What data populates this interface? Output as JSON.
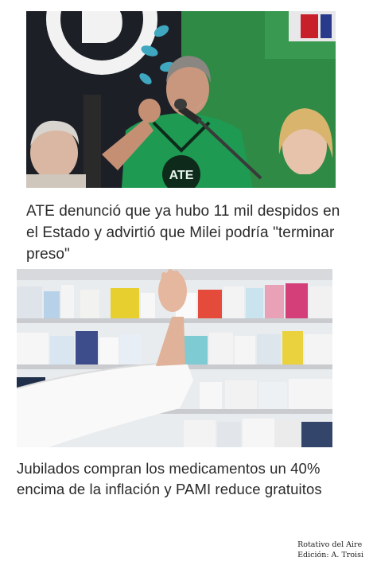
{
  "stories": [
    {
      "headline": "ATE denunció que ya hubo 11 mil despidos en el Estado y advirtió que Milei podría \"terminar preso\"",
      "image": "protest-speaker-photo"
    },
    {
      "headline": "Jubilados compran los medicamentos un 40% encima de la inflación y PAMI reduce gratuitos",
      "image": "pharmacy-shelves-photo"
    }
  ],
  "credits": {
    "line1": "Rotativo del Aire",
    "line2": "Edición: A. Troisi"
  },
  "colors": {
    "headline_text": "#2a2a2a",
    "shirt_green": "#1e9a52",
    "banner_green": "#2f8a46"
  }
}
